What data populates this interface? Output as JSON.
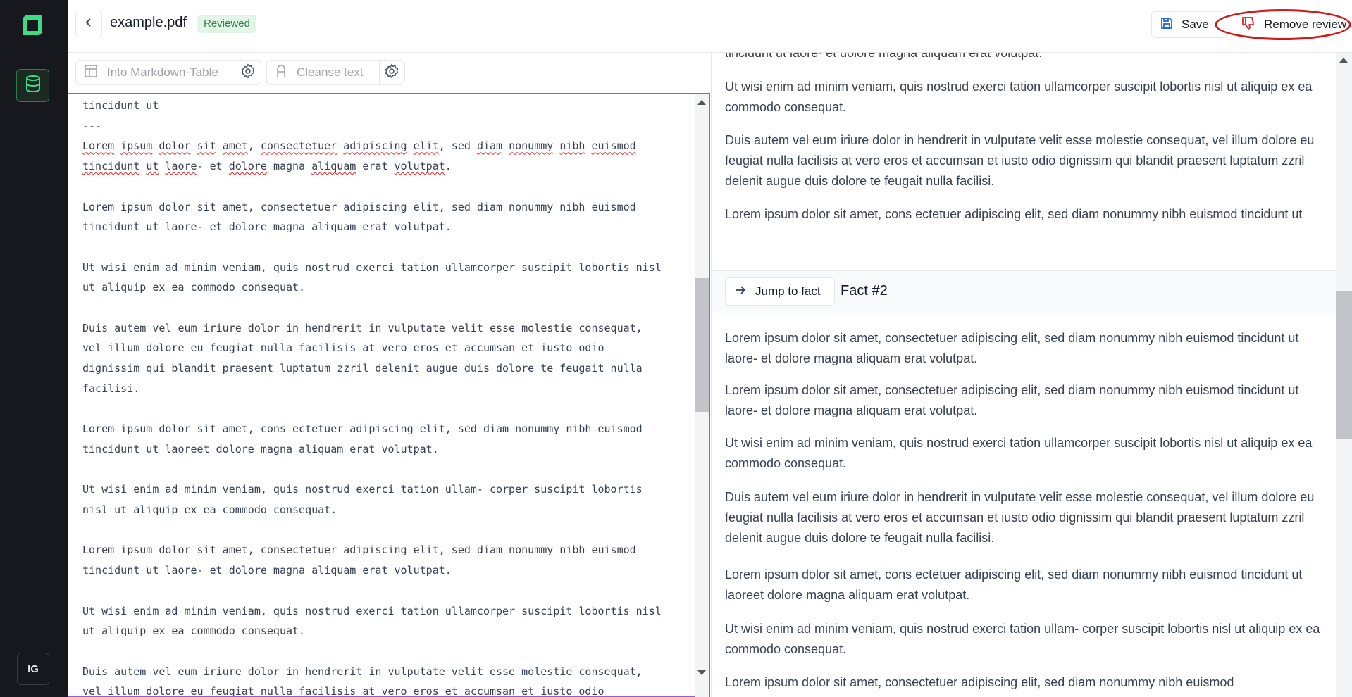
{
  "header": {
    "file_name": "example.pdf",
    "status_badge": "Reviewed",
    "save_label": "Save",
    "remove_review_label": "Remove review"
  },
  "sidebar": {
    "avatar_initials": "IG"
  },
  "toolbar": {
    "markdown_table_label": "Into Markdown-Table",
    "cleanse_label": "Cleanse text"
  },
  "editor": {
    "line1": "tincidunt ut",
    "line2": "---",
    "line3_parts": [
      "Lorem",
      "ipsum",
      "dolor",
      "sit",
      "amet",
      "consectetuer",
      "adipiscing",
      "elit",
      "sed",
      "diam",
      "nonummy",
      "nibh",
      "euismod"
    ],
    "line4_parts": [
      "tincidunt",
      "ut",
      "laore",
      "et",
      "dolore",
      "magna",
      "aliquam",
      "erat",
      "volutpat"
    ],
    "body": "\nLorem ipsum dolor sit amet, consectetuer adipiscing elit, sed diam nonummy nibh euismod\ntincidunt ut laore- et dolore magna aliquam erat volutpat.\n\nUt wisi enim ad minim veniam, quis nostrud exerci tation ullamcorper suscipit lobortis nisl\nut aliquip ex ea commodo consequat.\n\nDuis autem vel eum iriure dolor in hendrerit in vulputate velit esse molestie consequat,\nvel illum dolore eu feugiat nulla facilisis at vero eros et accumsan et iusto odio\ndignissim qui blandit praesent luptatum zzril delenit augue duis dolore te feugait nulla\nfacilisi.\n\nLorem ipsum dolor sit amet, cons ectetuer adipiscing elit, sed diam nonummy nibh euismod\ntincidunt ut laoreet dolore magna aliquam erat volutpat.\n\nUt wisi enim ad minim veniam, quis nostrud exerci tation ullam- corper suscipit lobortis\nnisl ut aliquip ex ea commodo consequat.\n\nLorem ipsum dolor sit amet, consectetuer adipiscing elit, sed diam nonummy nibh euismod\ntincidunt ut laore- et dolore magna aliquam erat volutpat.\n\nUt wisi enim ad minim veniam, quis nostrud exerci tation ullamcorper suscipit lobortis nisl\nut aliquip ex ea commodo consequat.\n\nDuis autem vel eum iriure dolor in hendrerit in vulputate velit esse molestie consequat,\nvel illum dolore eu feugiat nulla facilisis at vero eros et accumsan et iusto odio"
  },
  "preview": {
    "top_paragraphs": [
      "tincidunt ut laore- et dolore magna aliquam erat volutpat.",
      "Ut wisi enim ad minim veniam, quis nostrud exerci tation ullamcorper suscipit lobortis nisl ut aliquip ex ea commodo consequat.",
      "Duis autem vel eum iriure dolor in hendrerit in vulputate velit esse molestie consequat, vel illum dolore eu feugiat nulla facilisis at vero eros et accumsan et iusto odio dignissim qui blandit praesent luptatum zzril delenit augue duis dolore te feugait nulla facilisi.",
      "Lorem ipsum dolor sit amet, cons ectetuer adipiscing elit, sed diam nonummy nibh euismod tincidunt ut"
    ],
    "jump_label": "Jump to fact",
    "fact_title": "Fact #2",
    "fact_paragraphs": [
      "Lorem ipsum dolor sit amet, consectetuer adipiscing elit, sed diam nonummy nibh euismod tincidunt ut laore- et dolore magna aliquam erat volutpat.",
      "Lorem ipsum dolor sit amet, consectetuer adipiscing elit, sed diam nonummy nibh euismod tincidunt ut laore- et dolore magna aliquam erat volutpat.",
      "Ut wisi enim ad minim veniam, quis nostrud exerci tation ullamcorper suscipit lobortis nisl ut aliquip ex ea commodo consequat.",
      "Duis autem vel eum iriure dolor in hendrerit in vulputate velit esse molestie consequat, vel illum dolore eu feugiat nulla facilisis at vero eros et accumsan et iusto odio dignissim qui blandit praesent luptatum zzril delenit augue duis dolore te feugait nulla facilisi.",
      "Lorem ipsum dolor sit amet, cons ectetuer adipiscing elit, sed diam nonummy nibh euismod tincidunt ut laoreet dolore magna aliquam erat volutpat.",
      "Ut wisi enim ad minim veniam, quis nostrud exerci tation ullam- corper suscipit lobortis nisl ut aliquip ex ea commodo consequat.",
      "Lorem ipsum dolor sit amet, consectetuer adipiscing elit, sed diam nonummy nibh euismod"
    ]
  },
  "colors": {
    "sidebar_bg": "#16181d",
    "brand_green": "#3ddc84",
    "badge_bg": "#e3f5e8",
    "badge_text": "#2e7d46",
    "editor_border": "#9b59d6",
    "annotation_red": "#d11a1a"
  },
  "icons": {
    "logo": "app-logo",
    "database": "database-icon",
    "back": "chevron-left-icon",
    "save": "floppy-disk-icon",
    "remove_review": "thumbs-down-icon",
    "table": "table-icon",
    "cleanse": "text-cleanse-icon",
    "settings": "gear-icon",
    "jump": "arrow-right-icon"
  }
}
